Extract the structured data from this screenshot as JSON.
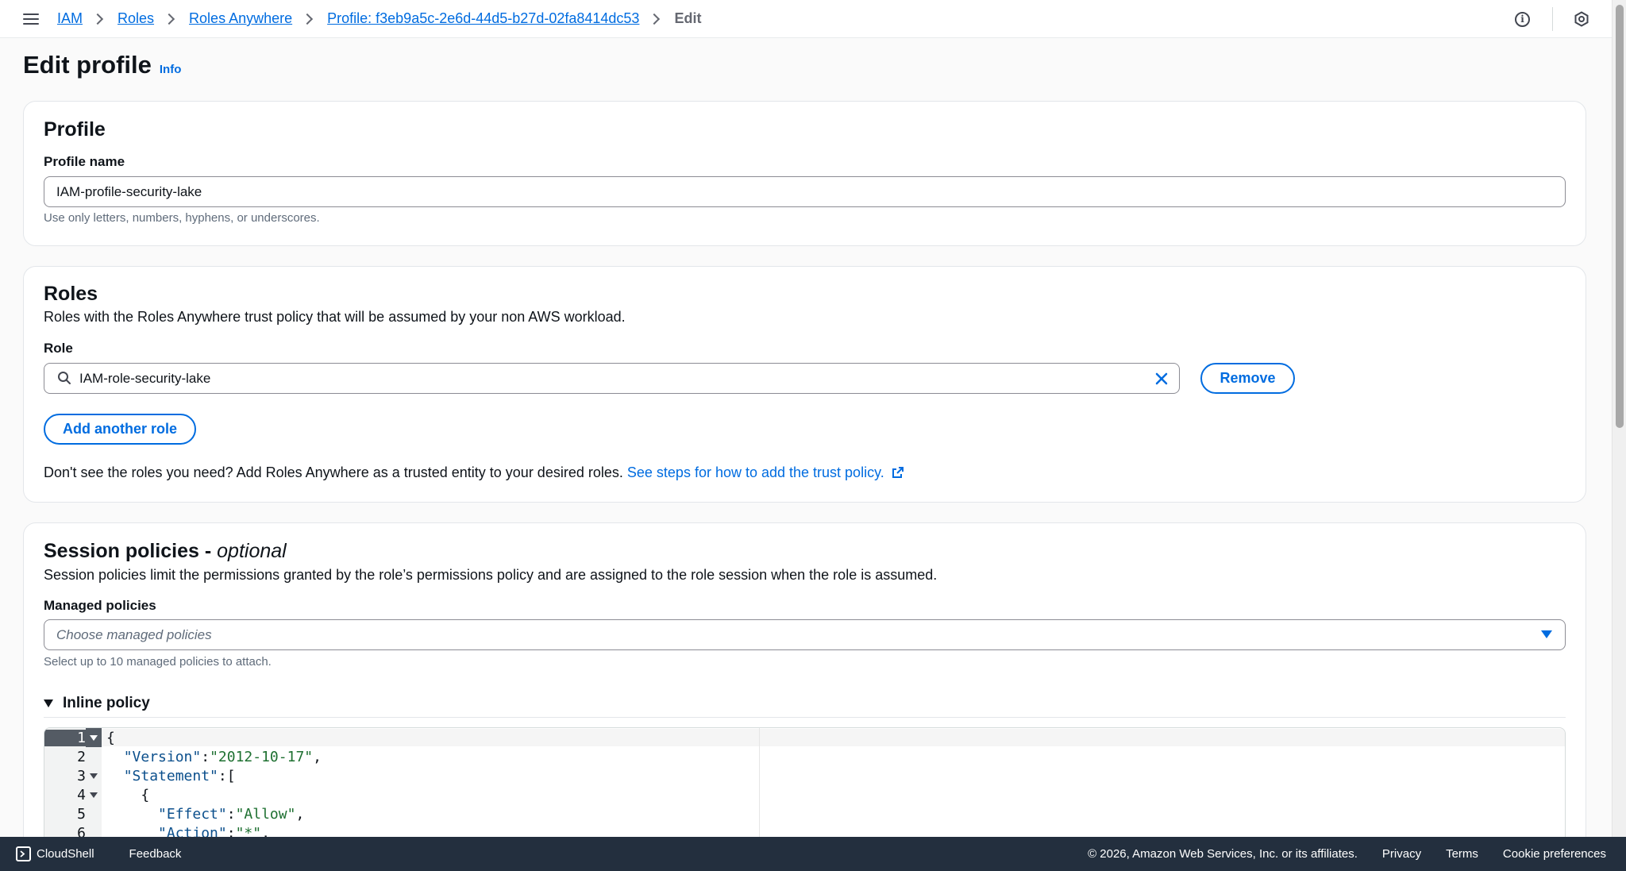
{
  "breadcrumbs": {
    "items": [
      "IAM",
      "Roles",
      "Roles Anywhere",
      "Profile: f3eb9a5c-2e6d-44d5-b27d-02fa8414dc53"
    ],
    "current": "Edit"
  },
  "page": {
    "title": "Edit profile",
    "info": "Info"
  },
  "profile": {
    "heading": "Profile",
    "name_label": "Profile name",
    "name_value": "IAM-profile-security-lake",
    "name_hint": "Use only letters, numbers, hyphens, or underscores."
  },
  "roles": {
    "heading": "Roles",
    "description": "Roles with the Roles Anywhere trust policy that will be assumed by your non AWS workload.",
    "role_label": "Role",
    "role_value": "IAM-role-security-lake",
    "remove_button": "Remove",
    "add_button": "Add another role",
    "trust_text": "Don't see the roles you need? Add Roles Anywhere as a trusted entity to your desired roles.",
    "trust_link": "See steps for how to add the trust policy."
  },
  "session": {
    "heading": "Session policies - ",
    "heading_optional": "optional",
    "description": "Session policies limit the permissions granted by the role’s permissions policy and are assigned to the role session when the role is assumed.",
    "managed_label": "Managed policies",
    "managed_placeholder": "Choose managed policies",
    "managed_hint": "Select up to 10 managed policies to attach.",
    "inline_label": "Inline policy"
  },
  "editor": {
    "lines": [
      {
        "n": "1",
        "text": "{"
      },
      {
        "n": "2",
        "text": "  \"Version\":\"2012-10-17\","
      },
      {
        "n": "3",
        "text": "  \"Statement\":["
      },
      {
        "n": "4",
        "text": "    {"
      },
      {
        "n": "5",
        "text": "      \"Effect\":\"Allow\","
      },
      {
        "n": "6",
        "text": "      \"Action\":\"*\","
      }
    ]
  },
  "footer": {
    "cloudshell": "CloudShell",
    "feedback": "Feedback",
    "copyright": "© 2026, Amazon Web Services, Inc. or its affiliates.",
    "privacy": "Privacy",
    "terms": "Terms",
    "cookies": "Cookie preferences"
  },
  "colors": {
    "link": "#006ce0",
    "footer_bg": "#232f3e",
    "text": "#0f141a"
  }
}
